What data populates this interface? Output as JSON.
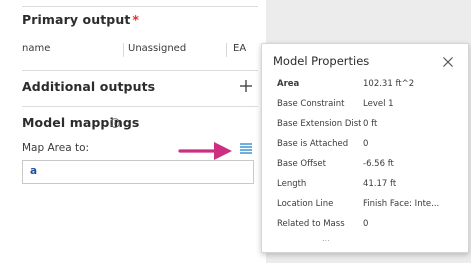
{
  "outputs": {
    "primary_title": "Primary output",
    "required_marker": "*",
    "row": {
      "name": "name",
      "status": "Unassigned",
      "short": "EA"
    },
    "additional_title": "Additional outputs"
  },
  "mappings": {
    "title": "Model mappings",
    "map_label": "Map Area to:",
    "input_value": "a"
  },
  "popup": {
    "title": "Model Properties",
    "properties": [
      {
        "name": "Area",
        "value": "102.31 ft^2"
      },
      {
        "name": "Base Constraint",
        "value": "Level 1"
      },
      {
        "name": "Base Extension Dist...",
        "value": "0 ft"
      },
      {
        "name": "Base is Attached",
        "value": "0"
      },
      {
        "name": "Base Offset",
        "value": "-6.56 ft"
      },
      {
        "name": "Length",
        "value": "41.17 ft"
      },
      {
        "name": "Location Line",
        "value": "Finish Face: Inte..."
      },
      {
        "name": "Related to Mass",
        "value": "0"
      }
    ],
    "more": "..."
  },
  "colors": {
    "accent": "#2f8fd2",
    "arrow": "#cc2f82",
    "required": "#e0312d"
  },
  "icons": {
    "add": "plus-icon",
    "info": "info-icon",
    "list": "list-icon",
    "close": "close-icon",
    "pointer": "arrow-icon"
  }
}
